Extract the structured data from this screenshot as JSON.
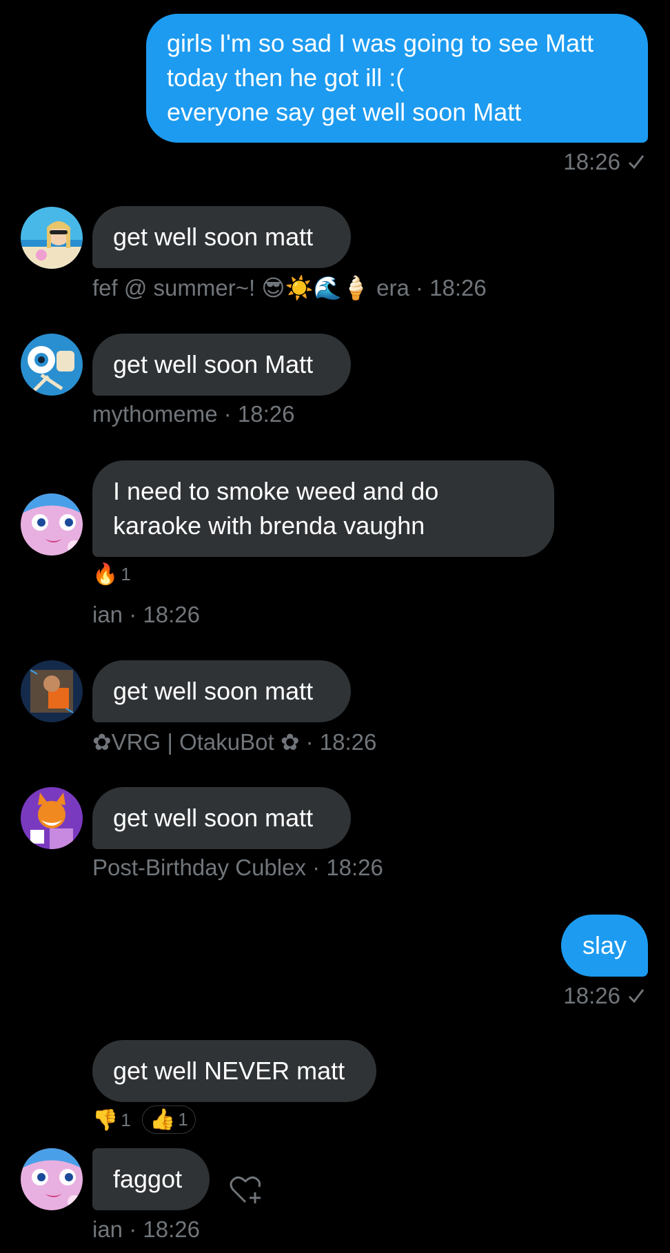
{
  "messages": {
    "m1": {
      "lines": [
        "girls I'm so sad I was going to see Matt",
        "today then he got ill :(",
        "everyone say get well soon Matt"
      ],
      "time": "18:26"
    },
    "m2": {
      "text": "get well soon matt",
      "sender": "fef @ summer~! 😎☀️🌊🍦 era",
      "time": "18:26"
    },
    "m3": {
      "text": "get well soon Matt",
      "sender": "mythomeme",
      "time": "18:26"
    },
    "m4": {
      "lines": [
        "I need to smoke weed and do",
        "karaoke with brenda vaughn"
      ],
      "reaction_emoji": "🔥",
      "reaction_count": "1",
      "sender": "ian",
      "time": "18:26"
    },
    "m5": {
      "text": "get well soon matt",
      "sender": "✿VRG | OtakuBot ✿",
      "time": "18:26"
    },
    "m6": {
      "text": "get well soon matt",
      "sender": "Post-Birthday Cublex",
      "time": "18:26"
    },
    "m7": {
      "text": "slay",
      "time": "18:26"
    },
    "m8": {
      "text": "get well NEVER matt",
      "reactions": [
        {
          "emoji": "👎",
          "count": "1"
        },
        {
          "emoji": "👍",
          "count": "1"
        }
      ]
    },
    "m9": {
      "text": "faggot",
      "sender": "ian",
      "time": "18:26"
    }
  },
  "separator": " · ",
  "colors": {
    "outgoing_bubble": "#1d9bf0",
    "incoming_bubble": "#2f3336",
    "meta_text": "#71767b",
    "background": "#000000"
  },
  "icons": {
    "read_check": "checkmark-icon",
    "add_reaction": "heart-plus-icon"
  }
}
